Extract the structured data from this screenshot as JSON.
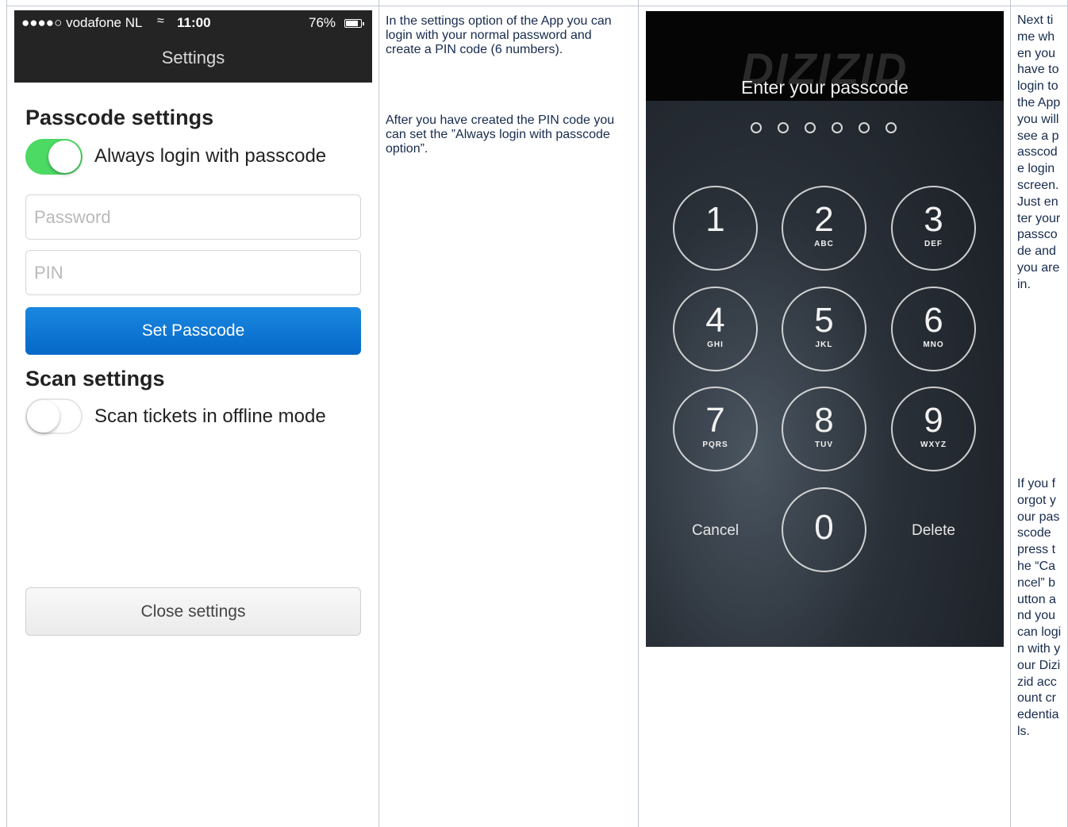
{
  "settings_screen": {
    "status_bar": {
      "carrier": "●●●●○ vodafone NL",
      "wifi_icon": "wifi-icon",
      "time": "11:00",
      "battery": "76%"
    },
    "title": "Settings",
    "passcode_heading": "Passcode settings",
    "always_login_toggle": {
      "label": "Always login with passcode",
      "on": true
    },
    "password_placeholder": "Password",
    "pin_placeholder": "PIN",
    "set_passcode_label": "Set Passcode",
    "scan_heading": "Scan settings",
    "offline_toggle": {
      "label": "Scan tickets in offline mode",
      "on": false
    },
    "close_settings_label": "Close settings",
    "colors": {
      "toggle_on": "#4cd964",
      "primary_button": "#0a78d8",
      "header_bg": "#242424"
    }
  },
  "description": {
    "paragraph_1": "In the settings option of the App you can login with your normal password and create a PIN code (6 numbers).",
    "paragraph_2": "After you have created the PIN code you can set the ”Always login with passcode option”."
  },
  "passcode_screen": {
    "logo_text": "DIZIZID",
    "heading": "Enter your passcode",
    "dot_count": 6,
    "keys": [
      {
        "num": "1",
        "letters": ""
      },
      {
        "num": "2",
        "letters": "ABC"
      },
      {
        "num": "3",
        "letters": "DEF"
      },
      {
        "num": "4",
        "letters": "GHI"
      },
      {
        "num": "5",
        "letters": "JKL"
      },
      {
        "num": "6",
        "letters": "MNO"
      },
      {
        "num": "7",
        "letters": "PQRS"
      },
      {
        "num": "8",
        "letters": "TUV"
      },
      {
        "num": "9",
        "letters": "WXYZ"
      },
      {
        "num": "0",
        "letters": ""
      }
    ],
    "cancel_label": "Cancel",
    "delete_label": "Delete"
  },
  "instructions": {
    "paragraph_1": "Next time when you have to login to the App you will see a passcode login screen. Just enter your passcode and you are in.",
    "paragraph_2": "If you forgot your passcode press the “Cancel” button and you can login with your Dizizid account credentials."
  }
}
